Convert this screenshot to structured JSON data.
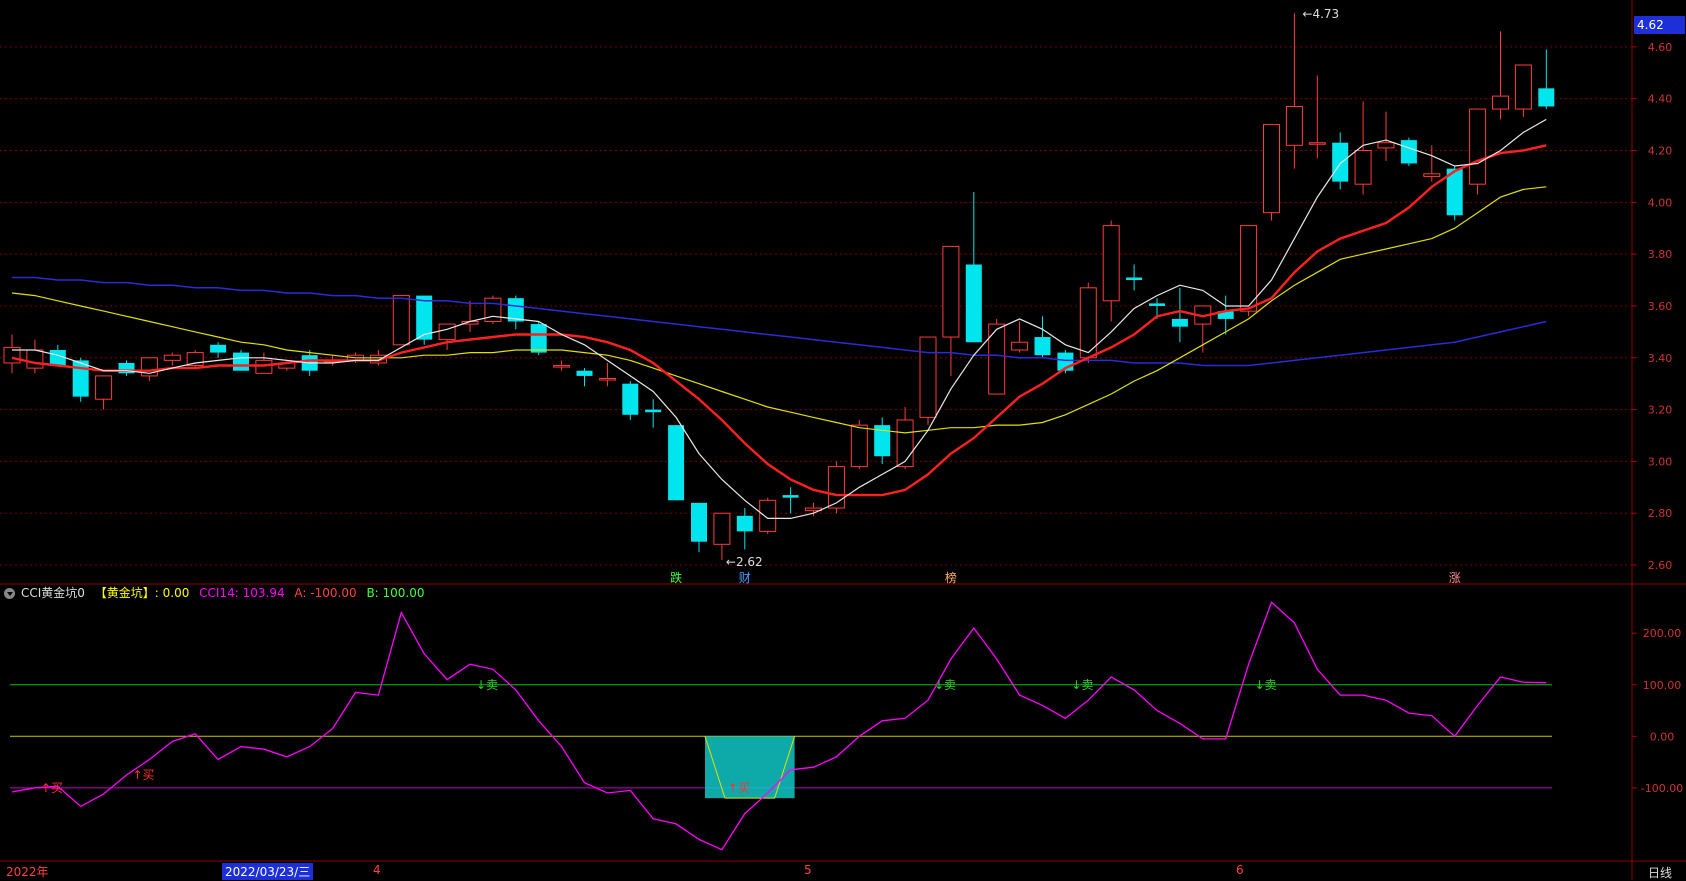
{
  "price_badge": "4.62",
  "cci_header": {
    "name": "CCI黄金坑0",
    "golden_label": "【黄金坑】: 0.00",
    "cci_label": "CCI14: 103.94",
    "a_label": "A: -100.00",
    "b_label": "B: 100.00"
  },
  "date_axis": {
    "year": "2022年",
    "current_date": "2022/03/23/三",
    "m4": "4",
    "m5": "5",
    "m6": "6"
  },
  "period_label": "日线",
  "colors": {
    "up": "#ff3b3b",
    "down": "#00e5ee",
    "ma_white": "#e8e8e8",
    "ma_red": "#ff2020",
    "ma_yellow": "#e0e000",
    "ma_blue": "#2b2bd8",
    "cci": "#ff00ff"
  },
  "chart_data": [
    {
      "type": "candlestick",
      "title": "",
      "ylim": [
        2.55,
        4.75
      ],
      "yticks": [
        "4.60",
        "4.40",
        "4.20",
        "4.00",
        "3.80",
        "3.60",
        "3.40",
        "3.20",
        "3.00",
        "2.80",
        "2.60"
      ],
      "annotations": {
        "high_label": "4.73",
        "low_label": "2.62"
      },
      "markers": [
        "跌",
        "财",
        "榜",
        "涨"
      ],
      "candles": [
        {
          "o": 3.38,
          "h": 3.49,
          "l": 3.34,
          "c": 3.44
        },
        {
          "o": 3.36,
          "h": 3.47,
          "l": 3.34,
          "c": 3.43
        },
        {
          "o": 3.43,
          "h": 3.45,
          "l": 3.37,
          "c": 3.37
        },
        {
          "o": 3.39,
          "h": 3.4,
          "l": 3.23,
          "c": 3.25
        },
        {
          "o": 3.24,
          "h": 3.33,
          "l": 3.2,
          "c": 3.33
        },
        {
          "o": 3.38,
          "h": 3.39,
          "l": 3.33,
          "c": 3.34
        },
        {
          "o": 3.33,
          "h": 3.4,
          "l": 3.31,
          "c": 3.4
        },
        {
          "o": 3.39,
          "h": 3.42,
          "l": 3.37,
          "c": 3.41
        },
        {
          "o": 3.37,
          "h": 3.43,
          "l": 3.36,
          "c": 3.42
        },
        {
          "o": 3.45,
          "h": 3.46,
          "l": 3.4,
          "c": 3.42
        },
        {
          "o": 3.42,
          "h": 3.43,
          "l": 3.35,
          "c": 3.35
        },
        {
          "o": 3.34,
          "h": 3.42,
          "l": 3.34,
          "c": 3.39
        },
        {
          "o": 3.36,
          "h": 3.39,
          "l": 3.35,
          "c": 3.38
        },
        {
          "o": 3.41,
          "h": 3.43,
          "l": 3.33,
          "c": 3.35
        },
        {
          "o": 3.39,
          "h": 3.41,
          "l": 3.37,
          "c": 3.39
        },
        {
          "o": 3.39,
          "h": 3.42,
          "l": 3.38,
          "c": 3.41
        },
        {
          "o": 3.38,
          "h": 3.43,
          "l": 3.37,
          "c": 3.41
        },
        {
          "o": 3.45,
          "h": 3.64,
          "l": 3.45,
          "c": 3.64
        },
        {
          "o": 3.64,
          "h": 3.64,
          "l": 3.45,
          "c": 3.47
        },
        {
          "o": 3.47,
          "h": 3.53,
          "l": 3.43,
          "c": 3.53
        },
        {
          "o": 3.53,
          "h": 3.62,
          "l": 3.5,
          "c": 3.54
        },
        {
          "o": 3.54,
          "h": 3.64,
          "l": 3.53,
          "c": 3.63
        },
        {
          "o": 3.63,
          "h": 3.64,
          "l": 3.51,
          "c": 3.54
        },
        {
          "o": 3.53,
          "h": 3.54,
          "l": 3.41,
          "c": 3.42
        },
        {
          "o": 3.37,
          "h": 3.39,
          "l": 3.35,
          "c": 3.37
        },
        {
          "o": 3.35,
          "h": 3.36,
          "l": 3.29,
          "c": 3.33
        },
        {
          "o": 3.32,
          "h": 3.38,
          "l": 3.29,
          "c": 3.32
        },
        {
          "o": 3.3,
          "h": 3.31,
          "l": 3.16,
          "c": 3.18
        },
        {
          "o": 3.2,
          "h": 3.24,
          "l": 3.13,
          "c": 3.19
        },
        {
          "o": 3.14,
          "h": 3.14,
          "l": 2.85,
          "c": 2.85
        },
        {
          "o": 2.84,
          "h": 2.84,
          "l": 2.65,
          "c": 2.69
        },
        {
          "o": 2.68,
          "h": 2.8,
          "l": 2.62,
          "c": 2.8
        },
        {
          "o": 2.79,
          "h": 2.82,
          "l": 2.66,
          "c": 2.73
        },
        {
          "o": 2.73,
          "h": 2.86,
          "l": 2.72,
          "c": 2.85
        },
        {
          "o": 2.87,
          "h": 2.9,
          "l": 2.8,
          "c": 2.86
        },
        {
          "o": 2.81,
          "h": 2.84,
          "l": 2.79,
          "c": 2.82
        },
        {
          "o": 2.82,
          "h": 3.0,
          "l": 2.8,
          "c": 2.98
        },
        {
          "o": 2.98,
          "h": 3.16,
          "l": 2.97,
          "c": 3.14
        },
        {
          "o": 3.14,
          "h": 3.17,
          "l": 2.99,
          "c": 3.02
        },
        {
          "o": 2.98,
          "h": 3.21,
          "l": 2.97,
          "c": 3.16
        },
        {
          "o": 3.17,
          "h": 3.31,
          "l": 3.14,
          "c": 3.48
        },
        {
          "o": 3.48,
          "h": 3.59,
          "l": 3.33,
          "c": 3.83
        },
        {
          "o": 3.76,
          "h": 4.04,
          "l": 3.46,
          "c": 3.46
        },
        {
          "o": 3.26,
          "h": 3.55,
          "l": 3.26,
          "c": 3.53
        },
        {
          "o": 3.43,
          "h": 3.54,
          "l": 3.42,
          "c": 3.46
        },
        {
          "o": 3.48,
          "h": 3.56,
          "l": 3.4,
          "c": 3.41
        },
        {
          "o": 3.42,
          "h": 3.43,
          "l": 3.34,
          "c": 3.35
        },
        {
          "o": 3.4,
          "h": 3.69,
          "l": 3.38,
          "c": 3.67
        },
        {
          "o": 3.62,
          "h": 3.93,
          "l": 3.54,
          "c": 3.91
        },
        {
          "o": 3.71,
          "h": 3.76,
          "l": 3.66,
          "c": 3.7
        },
        {
          "o": 3.61,
          "h": 3.63,
          "l": 3.55,
          "c": 3.6
        },
        {
          "o": 3.55,
          "h": 3.67,
          "l": 3.46,
          "c": 3.52
        },
        {
          "o": 3.53,
          "h": 3.59,
          "l": 3.42,
          "c": 3.6
        },
        {
          "o": 3.58,
          "h": 3.64,
          "l": 3.49,
          "c": 3.55
        },
        {
          "o": 3.58,
          "h": 3.91,
          "l": 3.56,
          "c": 3.91
        },
        {
          "o": 3.96,
          "h": 4.3,
          "l": 3.93,
          "c": 4.3
        },
        {
          "o": 4.22,
          "h": 4.73,
          "l": 4.13,
          "c": 4.37
        },
        {
          "o": 4.23,
          "h": 4.49,
          "l": 4.17,
          "c": 4.23
        },
        {
          "o": 4.23,
          "h": 4.27,
          "l": 4.05,
          "c": 4.08
        },
        {
          "o": 4.07,
          "h": 4.39,
          "l": 4.03,
          "c": 4.2
        },
        {
          "o": 4.21,
          "h": 4.35,
          "l": 4.16,
          "c": 4.23
        },
        {
          "o": 4.24,
          "h": 4.25,
          "l": 4.14,
          "c": 4.15
        },
        {
          "o": 4.1,
          "h": 4.22,
          "l": 4.08,
          "c": 4.11
        },
        {
          "o": 4.13,
          "h": 4.14,
          "l": 3.93,
          "c": 3.95
        },
        {
          "o": 4.07,
          "h": 4.36,
          "l": 4.03,
          "c": 4.36
        },
        {
          "o": 4.36,
          "h": 4.66,
          "l": 4.32,
          "c": 4.41
        },
        {
          "o": 4.36,
          "h": 4.53,
          "l": 4.33,
          "c": 4.53
        },
        {
          "o": 4.44,
          "h": 4.59,
          "l": 4.36,
          "c": 4.37
        }
      ],
      "ma5": [
        3.43,
        3.43,
        3.41,
        3.38,
        3.35,
        3.35,
        3.34,
        3.36,
        3.38,
        3.39,
        3.4,
        3.4,
        3.39,
        3.38,
        3.38,
        3.39,
        3.39,
        3.44,
        3.49,
        3.51,
        3.54,
        3.56,
        3.55,
        3.54,
        3.49,
        3.45,
        3.39,
        3.33,
        3.27,
        3.17,
        3.03,
        2.93,
        2.85,
        2.78,
        2.78,
        2.8,
        2.84,
        2.9,
        2.95,
        3.0,
        3.12,
        3.28,
        3.41,
        3.51,
        3.55,
        3.51,
        3.45,
        3.42,
        3.5,
        3.59,
        3.64,
        3.68,
        3.66,
        3.6,
        3.6,
        3.7,
        3.86,
        4.02,
        4.15,
        4.22,
        4.24,
        4.21,
        4.18,
        4.14,
        4.15,
        4.2,
        4.27,
        4.32
      ],
      "ma10": [
        3.4,
        3.38,
        3.37,
        3.36,
        3.35,
        3.35,
        3.35,
        3.36,
        3.36,
        3.37,
        3.37,
        3.37,
        3.38,
        3.39,
        3.39,
        3.39,
        3.39,
        3.42,
        3.44,
        3.46,
        3.47,
        3.48,
        3.49,
        3.49,
        3.49,
        3.48,
        3.46,
        3.43,
        3.38,
        3.31,
        3.24,
        3.16,
        3.07,
        2.99,
        2.93,
        2.89,
        2.87,
        2.87,
        2.87,
        2.89,
        2.95,
        3.03,
        3.09,
        3.17,
        3.25,
        3.3,
        3.36,
        3.4,
        3.44,
        3.49,
        3.56,
        3.58,
        3.56,
        3.58,
        3.59,
        3.63,
        3.73,
        3.81,
        3.86,
        3.89,
        3.92,
        3.98,
        4.06,
        4.12,
        4.16,
        4.19,
        4.2,
        4.22
      ],
      "ma20": [
        3.65,
        3.64,
        3.62,
        3.6,
        3.58,
        3.56,
        3.54,
        3.52,
        3.5,
        3.48,
        3.46,
        3.45,
        3.43,
        3.42,
        3.41,
        3.4,
        3.4,
        3.4,
        3.41,
        3.41,
        3.42,
        3.42,
        3.43,
        3.43,
        3.43,
        3.42,
        3.41,
        3.39,
        3.36,
        3.33,
        3.3,
        3.27,
        3.24,
        3.21,
        3.19,
        3.17,
        3.15,
        3.13,
        3.12,
        3.11,
        3.12,
        3.13,
        3.13,
        3.14,
        3.14,
        3.15,
        3.18,
        3.22,
        3.26,
        3.31,
        3.35,
        3.4,
        3.45,
        3.5,
        3.55,
        3.62,
        3.68,
        3.73,
        3.78,
        3.8,
        3.82,
        3.84,
        3.86,
        3.9,
        3.96,
        4.02,
        4.05,
        4.06
      ],
      "ma60": [
        3.71,
        3.71,
        3.7,
        3.7,
        3.69,
        3.69,
        3.68,
        3.68,
        3.67,
        3.67,
        3.66,
        3.66,
        3.65,
        3.65,
        3.64,
        3.64,
        3.63,
        3.63,
        3.62,
        3.62,
        3.61,
        3.61,
        3.6,
        3.59,
        3.58,
        3.57,
        3.56,
        3.55,
        3.54,
        3.53,
        3.52,
        3.51,
        3.5,
        3.49,
        3.48,
        3.47,
        3.46,
        3.45,
        3.44,
        3.43,
        3.42,
        3.42,
        3.41,
        3.41,
        3.4,
        3.4,
        3.39,
        3.39,
        3.39,
        3.38,
        3.38,
        3.38,
        3.37,
        3.37,
        3.37,
        3.38,
        3.39,
        3.4,
        3.41,
        3.42,
        3.43,
        3.44,
        3.45,
        3.46,
        3.48,
        3.5,
        3.52,
        3.54
      ]
    },
    {
      "type": "line",
      "title": "",
      "ylim": [
        -240,
        280
      ],
      "yticks": [
        "200.00",
        "100.00",
        "0.00",
        "-100.00"
      ],
      "reference_lines": [
        100,
        0,
        -100
      ],
      "signals": [
        "↑买",
        "↑买",
        "↓卖",
        "↑买",
        "↓卖",
        "↓卖",
        "↓卖"
      ],
      "series": [
        {
          "name": "CCI14",
          "values": [
            -108,
            -100,
            -97,
            -136,
            -112,
            -75,
            -45,
            -10,
            5,
            -45,
            -20,
            -25,
            -40,
            -20,
            15,
            85,
            80,
            240,
            160,
            110,
            140,
            130,
            90,
            30,
            -20,
            -90,
            -110,
            -105,
            -160,
            -170,
            -200,
            -220,
            -150,
            -110,
            -65,
            -60,
            -40,
            0,
            30,
            35,
            70,
            150,
            210,
            150,
            80,
            60,
            35,
            70,
            115,
            90,
            50,
            25,
            -5,
            -5,
            140,
            260,
            220,
            130,
            80,
            80,
            70,
            45,
            40,
            0,
            60,
            115,
            105,
            104
          ]
        }
      ]
    }
  ]
}
